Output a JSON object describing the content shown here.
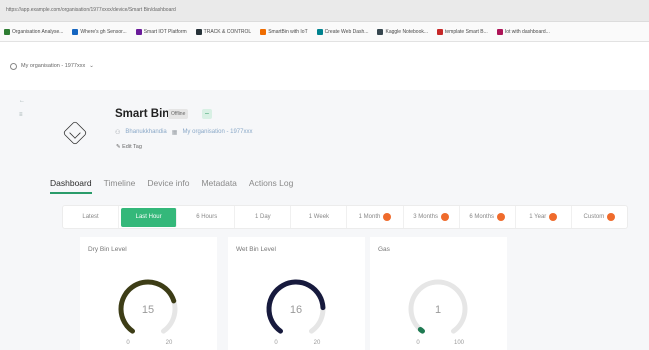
{
  "browser": {
    "url": "https://app.example.com/organisation/1977xxxx/device/Smart Bin/dashboard",
    "bookmarks": [
      {
        "label": "Organisation Analyse...",
        "color": "#2e7d32"
      },
      {
        "label": "Where's gh Sensor...",
        "color": "#1565c0"
      },
      {
        "label": "Smart IOT Platform",
        "color": "#6a1b9a"
      },
      {
        "label": "TRACK & CONTROL",
        "color": "#263238"
      },
      {
        "label": "SmartBin with IoT",
        "color": "#ef6c00"
      },
      {
        "label": "Create Web Dash...",
        "color": "#00838f"
      },
      {
        "label": "Kaggle Notebook...",
        "color": "#37474f"
      },
      {
        "label": "template Smart B...",
        "color": "#c62828"
      },
      {
        "label": "Iot with dashboard...",
        "color": "#ad1457"
      }
    ]
  },
  "org": {
    "name": "My organisation - 1977xxx"
  },
  "device": {
    "name": "Smart Bin",
    "status": "Offline",
    "owner": "Bhanukkhandia",
    "organisation": "My organisation - 1977xxx",
    "action": "Edit Tag"
  },
  "tabs": [
    "Dashboard",
    "Timeline",
    "Device info",
    "Metadata",
    "Actions Log"
  ],
  "active_tab": "Dashboard",
  "ranges": [
    {
      "label": "Latest",
      "locked": false
    },
    {
      "label": "Last Hour",
      "locked": false,
      "selected": true
    },
    {
      "label": "6 Hours",
      "locked": false
    },
    {
      "label": "1 Day",
      "locked": false
    },
    {
      "label": "1 Week",
      "locked": false
    },
    {
      "label": "1 Month",
      "locked": true
    },
    {
      "label": "3 Months",
      "locked": true
    },
    {
      "label": "6 Months",
      "locked": true
    },
    {
      "label": "1 Year",
      "locked": true
    },
    {
      "label": "Custom",
      "locked": true
    }
  ],
  "gauges": [
    {
      "title": "Dry Bin Level",
      "value": 15,
      "min": 0,
      "max": 20,
      "fraction": 0.75,
      "color": "#3d3d16"
    },
    {
      "title": "Wet Bin Level",
      "value": 16,
      "min": 0,
      "max": 20,
      "fraction": 0.8,
      "color": "#171a3d"
    },
    {
      "title": "Gas",
      "value": 1,
      "min": 0,
      "max": 100,
      "fraction": 0.02,
      "color": "#1f7a52"
    }
  ],
  "colors": {
    "accent": "#2a9c6a",
    "selected": "#34b87a",
    "locked": "#ef6b2c"
  },
  "icons": [
    "back-icon",
    "cube-icon",
    "user-icon",
    "building-icon",
    "pencil-icon",
    "lock-icon"
  ]
}
